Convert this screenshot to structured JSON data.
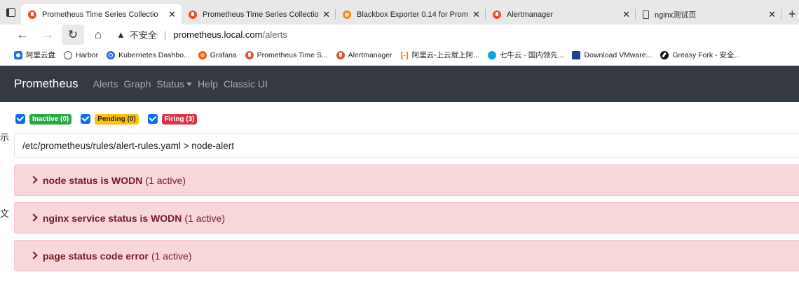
{
  "browser": {
    "tabs": [
      {
        "title": "Prometheus Time Series Collectio",
        "icon": "prometheus-icon",
        "active": true
      },
      {
        "title": "Prometheus Time Series Collectio",
        "icon": "prometheus-icon",
        "active": false
      },
      {
        "title": "Blackbox Exporter 0.14 for Prome",
        "icon": "blackbox-icon",
        "active": false
      },
      {
        "title": "Alertmanager",
        "icon": "prometheus-icon",
        "active": false
      },
      {
        "title": "nginx测试页",
        "icon": "document-icon",
        "active": false
      }
    ],
    "address": {
      "security_label": "不安全",
      "host": "prometheus.local.com",
      "path": "/alerts"
    },
    "bookmarks": [
      {
        "label": "阿里云盘",
        "icon": "aliyun-drive-icon"
      },
      {
        "label": "Harbor",
        "icon": "harbor-icon"
      },
      {
        "label": "Kubernetes Dashbo...",
        "icon": "kubernetes-icon"
      },
      {
        "label": "Grafana",
        "icon": "grafana-icon"
      },
      {
        "label": "Prometheus Time S...",
        "icon": "prometheus-icon"
      },
      {
        "label": "Alertmanager",
        "icon": "prometheus-icon"
      },
      {
        "label": "阿里云-上云就上阿...",
        "icon": "aliyun-icon"
      },
      {
        "label": "七牛云 - 国内领先...",
        "icon": "qiniu-icon"
      },
      {
        "label": "Download VMware...",
        "icon": "vmware-icon"
      },
      {
        "label": "Greasy Fork - 安全...",
        "icon": "greasyfork-icon"
      }
    ]
  },
  "app": {
    "brand": "Prometheus",
    "nav": [
      "Alerts",
      "Graph",
      "Status",
      "Help",
      "Classic UI"
    ],
    "filters": [
      {
        "label": "Inactive (0)",
        "kind": "inactive",
        "checked": true
      },
      {
        "label": "Pending (0)",
        "kind": "pending",
        "checked": true
      },
      {
        "label": "Firing (3)",
        "kind": "firing",
        "checked": true
      }
    ],
    "rule_group_path": "/etc/prometheus/rules/alert-rules.yaml > node-alert",
    "alerts": [
      {
        "name": "node status is WODN",
        "count": "(1 active)"
      },
      {
        "name": "nginx service status is WODN",
        "count": "(1 active)"
      },
      {
        "name": "page status code error",
        "count": "(1 active)"
      }
    ]
  },
  "edge_fragments": [
    "示",
    "文"
  ],
  "colors": {
    "navbar": "#343a40",
    "inactive": "#28a745",
    "pending": "#ffc107",
    "firing": "#dc3545",
    "alert_bg": "#f8d7da",
    "alert_text": "#721c24"
  }
}
